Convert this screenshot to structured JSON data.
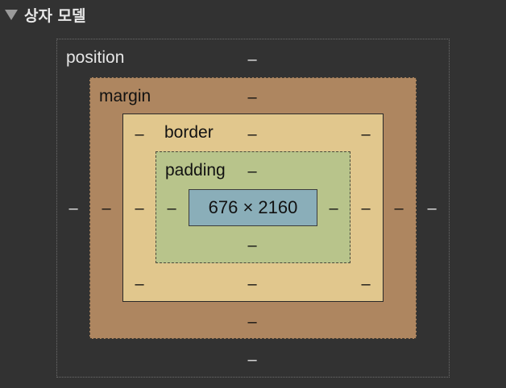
{
  "header": {
    "title": "상자 모델",
    "toggle_icon": "triangle-down-icon"
  },
  "position": {
    "label": "position",
    "top": "–",
    "right": "–",
    "bottom": "–",
    "left": "–"
  },
  "margin": {
    "label": "margin",
    "top": "–",
    "right": "–",
    "bottom": "–",
    "left": "–"
  },
  "border": {
    "label": "border",
    "top": "–",
    "top_left": "–",
    "top_right": "–",
    "bottom": "–",
    "bottom_left": "–",
    "bottom_right": "–",
    "left": "–",
    "right": "–"
  },
  "padding": {
    "label": "padding",
    "top": "–",
    "right": "–",
    "bottom": "–",
    "left": "–"
  },
  "content": {
    "size": "676 × 2160"
  },
  "colors": {
    "background": "#323232",
    "margin": "#ae8660",
    "border": "#e1c78d",
    "padding": "#b8c48b",
    "content": "#8aaeb9"
  }
}
